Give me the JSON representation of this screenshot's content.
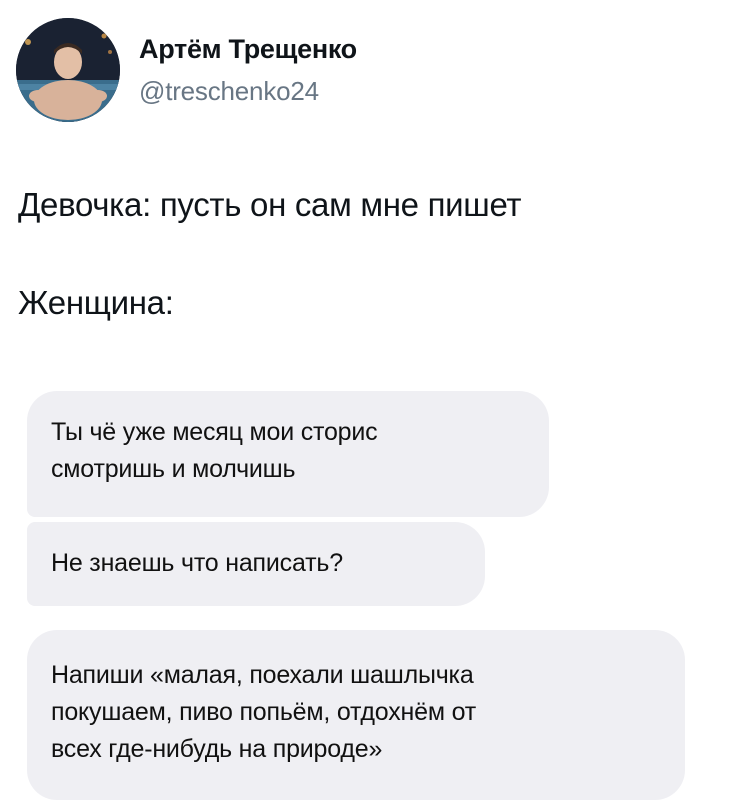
{
  "author": {
    "name": "Артём Трещенко",
    "handle": "@treschenko24",
    "avatar_icon": "profile-photo"
  },
  "tweet": {
    "line_1": "Девочка: пусть он сам мне пишет",
    "line_2": "Женщина:"
  },
  "messages": [
    {
      "text": "Ты чё уже месяц мои сторис\nсмотришь и молчишь"
    },
    {
      "text": "Не знаешь что написать?"
    },
    {
      "text": "Напиши «малая, поехали шашлычка\nпокушаем, пиво попьём, отдохнём от\nвсех где-нибудь на природе»"
    }
  ],
  "colors": {
    "text_primary": "#0f1419",
    "text_secondary": "#687684",
    "bubble_background": "#efeff3"
  }
}
